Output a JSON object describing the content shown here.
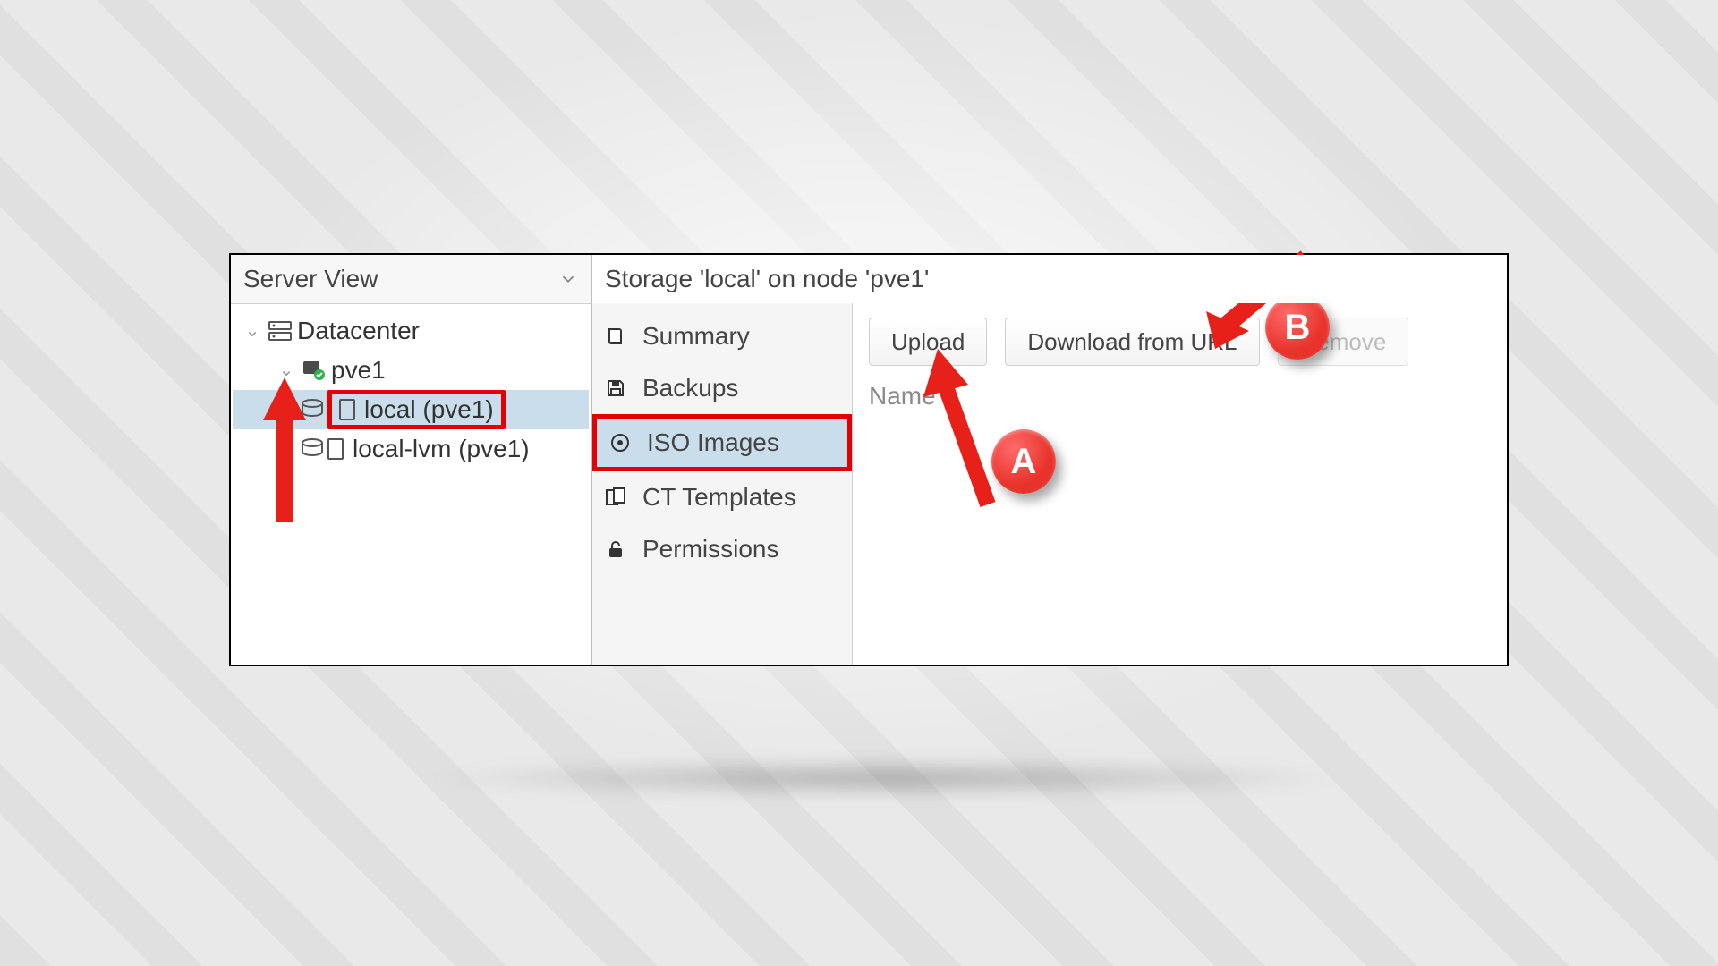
{
  "tree": {
    "header": "Server View",
    "root": "Datacenter",
    "node": "pve1",
    "storage_local": "local (pve1)",
    "storage_lvm": "local-lvm (pve1)"
  },
  "storage_title": "Storage 'local' on node 'pve1'",
  "subnav": {
    "summary": "Summary",
    "backups": "Backups",
    "iso": "ISO Images",
    "ct": "CT Templates",
    "perm": "Permissions"
  },
  "toolbar": {
    "upload": "Upload",
    "download": "Download from URL",
    "remove": "Remove"
  },
  "table": {
    "col_name": "Name"
  },
  "annotations": {
    "a": "A",
    "b": "B"
  }
}
